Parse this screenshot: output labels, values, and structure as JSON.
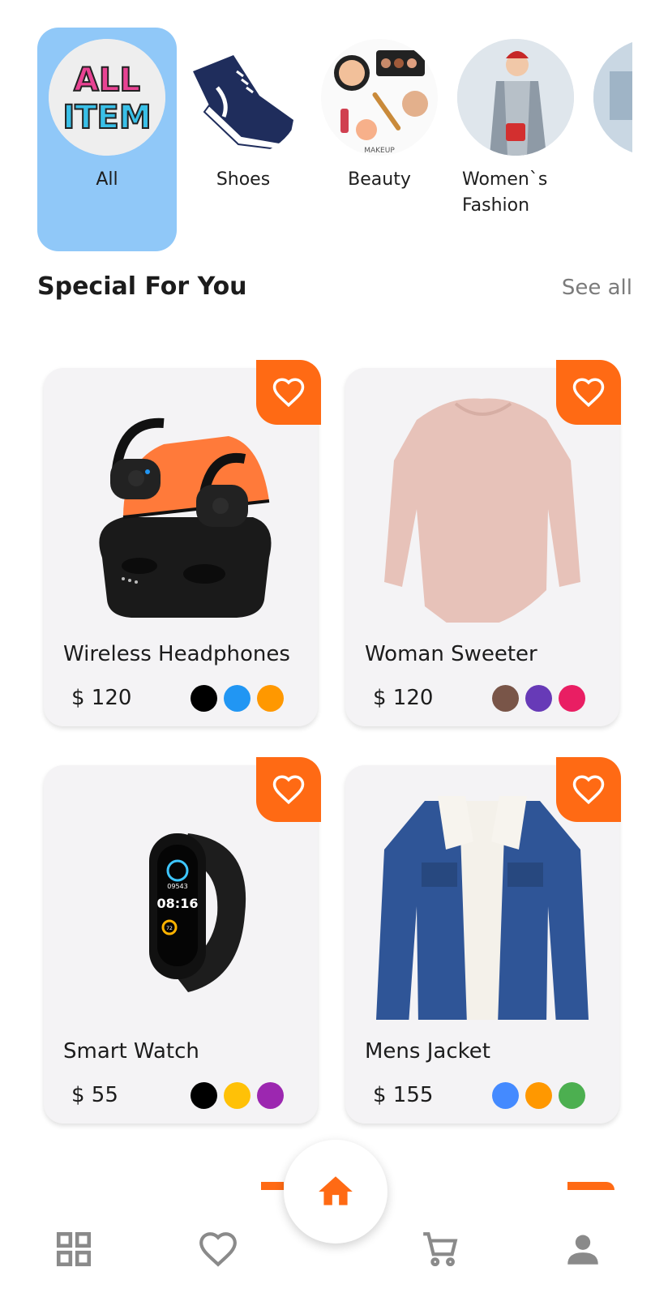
{
  "categories": [
    {
      "label": "All",
      "selected": true,
      "icon": "all-items-logo"
    },
    {
      "label": "Shoes",
      "selected": false,
      "icon": "sneaker-image"
    },
    {
      "label": "Beauty",
      "selected": false,
      "icon": "makeup-image",
      "caption": "MAKEUP"
    },
    {
      "label": "Women`s Fashion",
      "selected": false,
      "icon": "women-fashion-image"
    }
  ],
  "all_logo": {
    "line1": "ALL",
    "line2": "ITEM"
  },
  "section": {
    "title": "Special For You",
    "see_all": "See all"
  },
  "products": [
    {
      "name": "Wireless Headphones",
      "price": "$ 120",
      "colors": [
        "#000000",
        "#2196f3",
        "#ff9800"
      ],
      "image": "earbuds-image"
    },
    {
      "name": "Woman Sweeter",
      "price": "$ 120",
      "colors": [
        "#795548",
        "#673ab7",
        "#e91e63"
      ],
      "image": "sweater-image"
    },
    {
      "name": "Smart Watch",
      "price": "$ 55",
      "colors": [
        "#000000",
        "#ffc107",
        "#9c27b0"
      ],
      "image": "smartwatch-image"
    },
    {
      "name": "Mens Jacket",
      "price": "$ 155",
      "colors": [
        "#448aff",
        "#ff9800",
        "#4caf50"
      ],
      "image": "denim-jacket-image"
    }
  ],
  "watch_face": {
    "steps": "09543",
    "time": "08:16",
    "number": "72"
  },
  "nav": [
    "grid-icon",
    "heart-icon",
    "home-icon",
    "cart-icon",
    "profile-icon"
  ],
  "colors": {
    "accent": "#ff6a14",
    "selected_category": "#90c8f8",
    "card_bg": "#f4f3f5",
    "nav_icon": "#8a8a8a"
  }
}
